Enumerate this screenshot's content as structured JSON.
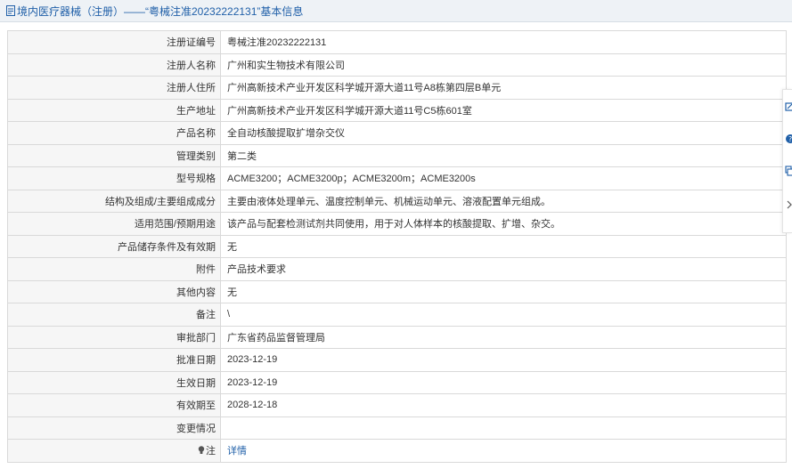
{
  "header": {
    "title": "境内医疗器械（注册）——“粤械注准20232222131”基本信息",
    "icon": "document-icon",
    "color": "#1f5fa8"
  },
  "rows": [
    {
      "label": "注册证编号",
      "value": "粤械注准20232222131"
    },
    {
      "label": "注册人名称",
      "value": "广州和实生物技术有限公司"
    },
    {
      "label": "注册人住所",
      "value": "广州高新技术产业开发区科学城开源大道11号A8栋第四层B单元"
    },
    {
      "label": "生产地址",
      "value": "广州高新技术产业开发区科学城开源大道11号C5栋601室"
    },
    {
      "label": "产品名称",
      "value": "全自动核酸提取扩增杂交仪"
    },
    {
      "label": "管理类别",
      "value": "第二类"
    },
    {
      "label": "型号规格",
      "value": "ACME3200；ACME3200p；ACME3200m；ACME3200s"
    },
    {
      "label": "结构及组成/主要组成成分",
      "value": "主要由液体处理单元、温度控制单元、机械运动单元、溶液配置单元组成。"
    },
    {
      "label": "适用范围/预期用途",
      "value": "该产品与配套检测试剂共同使用，用于对人体样本的核酸提取、扩增、杂交。"
    },
    {
      "label": "产品储存条件及有效期",
      "value": "无"
    },
    {
      "label": "附件",
      "value": "产品技术要求"
    },
    {
      "label": "其他内容",
      "value": "无"
    },
    {
      "label": "备注",
      "value": "\\"
    },
    {
      "label": "审批部门",
      "value": "广东省药品监督管理局"
    },
    {
      "label": "批准日期",
      "value": "2023-12-19"
    },
    {
      "label": "生效日期",
      "value": "2023-12-19"
    },
    {
      "label": "有效期至",
      "value": "2028-12-18"
    },
    {
      "label": "变更情况",
      "value": ""
    }
  ],
  "note_row": {
    "label": "注",
    "link": "详情",
    "icon": "lightbulb-icon"
  },
  "side_tools": [
    "edit-icon",
    "help-icon",
    "copy-icon",
    "chevron-right-icon"
  ]
}
